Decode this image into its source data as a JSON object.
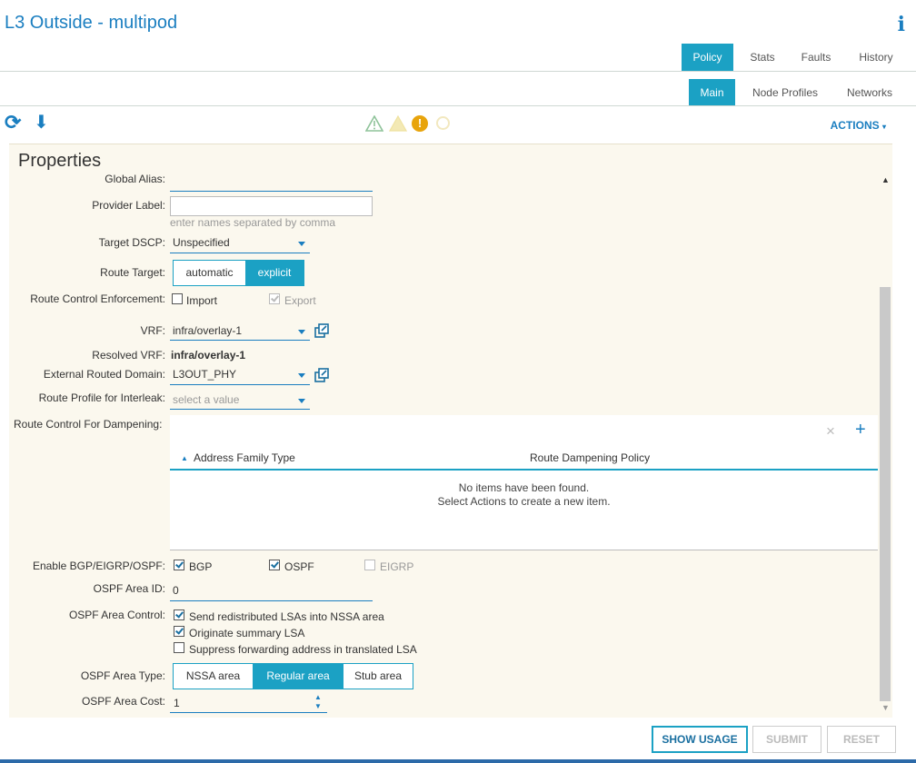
{
  "header": {
    "title": "L3 Outside - multipod",
    "info_glyph": "i"
  },
  "tabs_top": [
    "Policy",
    "Stats",
    "Faults",
    "History"
  ],
  "tabs_sub": [
    "Main",
    "Node Profiles",
    "Networks"
  ],
  "toolbar": {
    "actions_label": "ACTIONS",
    "refresh_glyph": "⟳",
    "download_glyph": "⬇",
    "fault_glyph": "!"
  },
  "properties": {
    "title": "Properties",
    "scroll_up_glyph": "▲",
    "scroll_down_glyph": "▼",
    "global_alias_label": "Global Alias:",
    "global_alias_value": "",
    "provider_label_label": "Provider Label:",
    "provider_label_hint": "enter names separated by comma",
    "target_dscp_label": "Target DSCP:",
    "target_dscp_value": "Unspecified",
    "route_target_label": "Route Target:",
    "route_target_options": [
      "automatic",
      "explicit"
    ],
    "route_target_selected": "explicit",
    "rce_label": "Route Control Enforcement:",
    "rce_import": "Import",
    "rce_export": "Export",
    "vrf_label": "VRF:",
    "vrf_value": "infra/overlay-1",
    "resolved_vrf_label": "Resolved VRF:",
    "resolved_vrf_value": "infra/overlay-1",
    "ext_domain_label": "External Routed Domain:",
    "ext_domain_value": "L3OUT_PHY",
    "route_profile_label": "Route Profile for Interleak:",
    "route_profile_placeholder": "select a value",
    "dampening_label": "Route Control For Dampening:",
    "dampening_table": {
      "col1": "Address Family Type",
      "col2": "Route Dampening Policy",
      "empty_line1": "No items have been found.",
      "empty_line2": "Select Actions to create a new item.",
      "sort_glyph": "▲",
      "close_glyph": "×",
      "add_glyph": "+"
    },
    "protocol_label": "Enable BGP/EIGRP/OSPF:",
    "protocol_bgp": "BGP",
    "protocol_ospf": "OSPF",
    "protocol_eigrp": "EIGRP",
    "ospf_area_id_label": "OSPF Area ID:",
    "ospf_area_id_value": "0",
    "ospf_area_control_label": "OSPF Area Control:",
    "ospf_area_control_options": [
      "Send redistributed LSAs into NSSA area",
      "Originate summary LSA",
      "Suppress forwarding address in translated LSA"
    ],
    "ospf_area_type_label": "OSPF Area Type:",
    "ospf_area_type_options": [
      "NSSA area",
      "Regular area",
      "Stub area"
    ],
    "ospf_area_type_selected": "Regular area",
    "ospf_area_cost_label": "OSPF Area Cost:",
    "ospf_area_cost_value": "1",
    "spinner_up_glyph": "▲",
    "spinner_down_glyph": "▼"
  },
  "footer": {
    "show_usage": "SHOW USAGE",
    "submit": "SUBMIT",
    "reset": "RESET"
  },
  "colors": {
    "accent": "#1ba1c4",
    "title": "#1a7ec0",
    "panel_bg": "#fbf8ee"
  }
}
